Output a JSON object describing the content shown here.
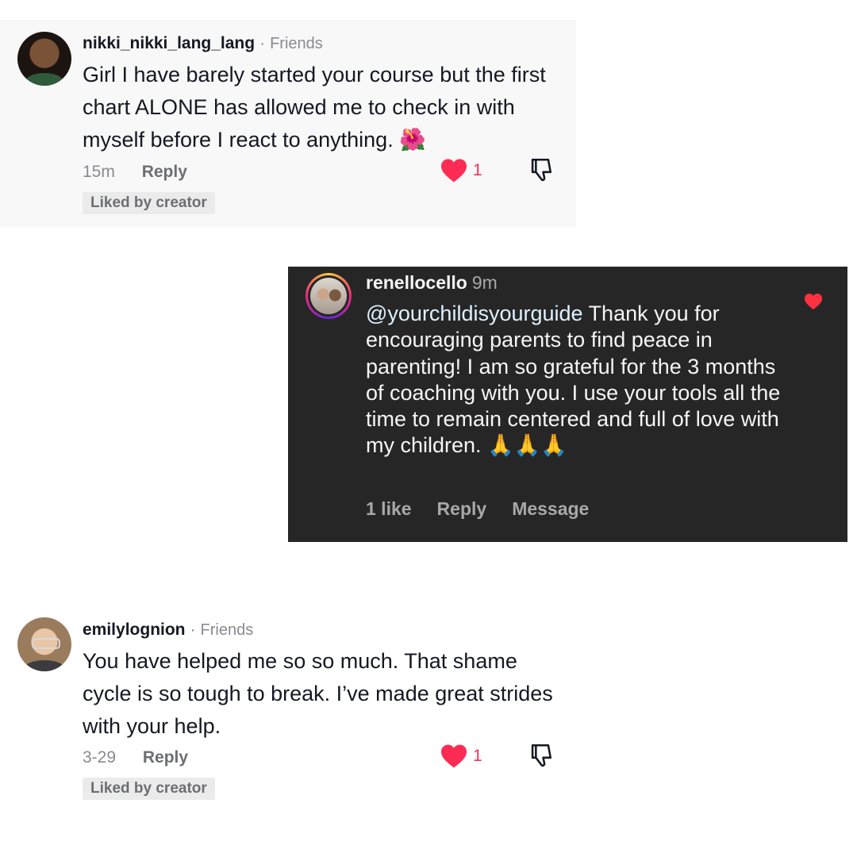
{
  "comments": [
    {
      "username": "nikki_nikki_lang_lang",
      "relation": "Friends",
      "text": "Girl I have barely started your course but the first chart ALONE has allowed me to check in with myself before I react to anything.",
      "emoji": "🌺",
      "time": "15m",
      "reply_label": "Reply",
      "like_count": "1",
      "liked": true,
      "badge": "Liked by creator"
    },
    {
      "username": "renellocello",
      "time": "9m",
      "mention": "@yourchildisyourguide",
      "text": " Thank you for encouraging parents to find peace in parenting! I am so grateful for the 3 months of coaching with you. I use your tools all the time to remain centered and full of love with my children.",
      "emoji": "🙏🙏🙏",
      "likes_label": "1 like",
      "reply_label": "Reply",
      "message_label": "Message",
      "liked": true
    },
    {
      "username": "emilylognion",
      "relation": "Friends",
      "text": "You have helped me so so much. That shame cycle is so tough to break. I’ve made great strides with your help.",
      "time": "3-29",
      "reply_label": "Reply",
      "like_count": "1",
      "liked": true,
      "badge": "Liked by creator"
    }
  ],
  "colors": {
    "like_red": "#fe2c55",
    "ig_heart_red": "#ff3040",
    "ig_background": "#262626",
    "tt_card_background": "#f8f8f8"
  },
  "icons": [
    "heart-icon",
    "dislike-icon",
    "hibiscus-emoji",
    "praying-hands-emoji"
  ]
}
